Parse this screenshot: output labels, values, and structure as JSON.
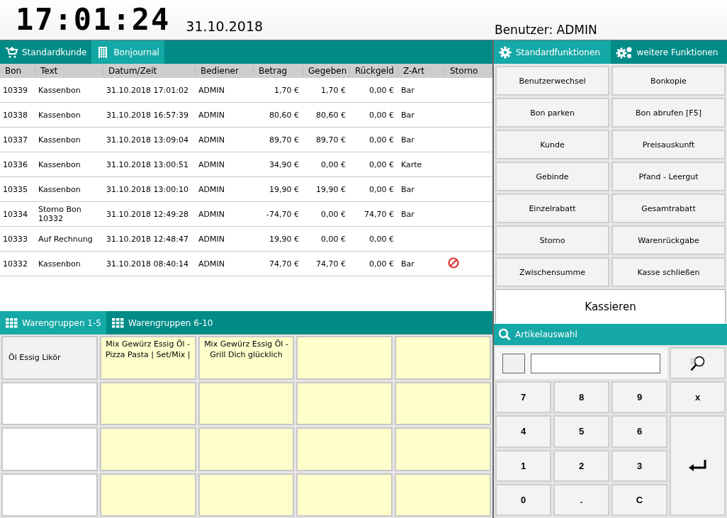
{
  "header": {
    "clock": "17:01:24",
    "date": "31.10.2018",
    "user": "Benutzer: ADMIN"
  },
  "left_tabs": [
    {
      "label": "Standardkunde",
      "selected": false
    },
    {
      "label": "Bonjournal",
      "selected": true
    }
  ],
  "table": {
    "columns": [
      "Bon",
      "Text",
      "Datum/Zeit",
      "Bediener",
      "Betrag",
      "Gegeben",
      "Rückgeld",
      "Z-Art",
      "Storno"
    ],
    "rows": [
      {
        "bon": "10339",
        "text": "Kassenbon",
        "datetime": "31.10.2018 17:01:02",
        "user": "ADMIN",
        "amount": "1,70 €",
        "given": "1,70 €",
        "change": "0,00 €",
        "payment": "Bar",
        "storno": false
      },
      {
        "bon": "10338",
        "text": "Kassenbon",
        "datetime": "31.10.2018 16:57:39",
        "user": "ADMIN",
        "amount": "80,60 €",
        "given": "80,60 €",
        "change": "0,00 €",
        "payment": "Bar",
        "storno": false
      },
      {
        "bon": "10337",
        "text": "Kassenbon",
        "datetime": "31.10.2018 13:09:04",
        "user": "ADMIN",
        "amount": "89,70 €",
        "given": "89,70 €",
        "change": "0,00 €",
        "payment": "Bar",
        "storno": false
      },
      {
        "bon": "10336",
        "text": "Kassenbon",
        "datetime": "31.10.2018 13:00:51",
        "user": "ADMIN",
        "amount": "34,90 €",
        "given": "0,00 €",
        "change": "0,00 €",
        "payment": "Karte",
        "storno": false
      },
      {
        "bon": "10335",
        "text": "Kassenbon",
        "datetime": "31.10.2018 13:00:10",
        "user": "ADMIN",
        "amount": "19,90 €",
        "given": "19,90 €",
        "change": "0,00 €",
        "payment": "Bar",
        "storno": false
      },
      {
        "bon": "10334",
        "text": "Storno Bon 10332",
        "datetime": "31.10.2018 12:49:28",
        "user": "ADMIN",
        "amount": "-74,70 €",
        "given": "0,00 €",
        "change": "74,70 €",
        "payment": "Bar",
        "storno": false
      },
      {
        "bon": "10333",
        "text": "Auf Rechnung",
        "datetime": "31.10.2018 12:48:47",
        "user": "ADMIN",
        "amount": "19,90 €",
        "given": "0,00 €",
        "change": "0,00 €",
        "storno": false
      },
      {
        "bon": "10332",
        "text": "Kassenbon",
        "datetime": "31.10.2018 08:40:14",
        "user": "ADMIN",
        "amount": "74,70 €",
        "given": "74,70 €",
        "change": "0,00 €",
        "payment": "Bar",
        "storno": true
      }
    ]
  },
  "group_tabs": [
    {
      "label": "Warengruppen 1-5",
      "selected": true
    },
    {
      "label": "Warengruppen 6-10",
      "selected": false
    }
  ],
  "products": [
    {
      "label": "Öl Essig Likör",
      "color": "#f2f2f2"
    },
    {
      "label": "Mix Gewürz Essig Öl - Pizza  Pasta | Set/Mix |",
      "color": "#ffffcc"
    },
    {
      "label": "Mix Gewürz Essig Öl - Grill Dich glücklich",
      "color": "#ffffcc"
    },
    {
      "color": "#ffffcc"
    },
    {
      "color": "#ffffcc"
    },
    {
      "color": "#ffffff"
    },
    {
      "color": "#ffffcc"
    },
    {
      "color": "#ffffcc"
    },
    {
      "color": "#ffffcc"
    },
    {
      "color": "#ffffcc"
    },
    {
      "color": "#ffffff"
    },
    {
      "color": "#ffffcc"
    },
    {
      "color": "#ffffcc"
    },
    {
      "color": "#ffffcc"
    },
    {
      "color": "#ffffcc"
    },
    {
      "color": "#ffffff"
    },
    {
      "color": "#ffffcc"
    },
    {
      "color": "#ffffcc"
    },
    {
      "color": "#ffffcc"
    },
    {
      "color": "#ffffcc"
    }
  ],
  "function_tabs": [
    {
      "label": "Standardfunktionen",
      "selected": true
    },
    {
      "label": "weitere Funktionen",
      "selected": false
    }
  ],
  "functions": [
    "Benutzerwechsel",
    "Bonkopie",
    "Bon parken",
    "Bon abrufen [F5]",
    "Kunde",
    "Preisauskunft",
    "Gebinde",
    "Pfand - Leergut",
    "Einzelrabatt",
    "Gesamtrabatt",
    "Storno",
    "Warenrückgabe",
    "Zwischensumme",
    "Kasse schließen"
  ],
  "checkout": "Kassieren",
  "article_panel": {
    "title": "Artikelauswahl"
  },
  "keypad": [
    {
      "kind": "key",
      "label": "7"
    },
    {
      "kind": "key",
      "label": "8"
    },
    {
      "kind": "key",
      "label": "9"
    },
    {
      "kind": "key",
      "label": "x"
    },
    {
      "kind": "key",
      "label": "4"
    },
    {
      "kind": "key",
      "label": "5"
    },
    {
      "kind": "key",
      "label": "6"
    },
    {
      "kind": "enter"
    },
    {
      "kind": "key",
      "label": "1"
    },
    {
      "kind": "key",
      "label": "2"
    },
    {
      "kind": "key",
      "label": "3"
    },
    {
      "kind": "key",
      "label": "0"
    },
    {
      "kind": "key",
      "label": "."
    },
    {
      "kind": "key",
      "label": "C"
    }
  ]
}
